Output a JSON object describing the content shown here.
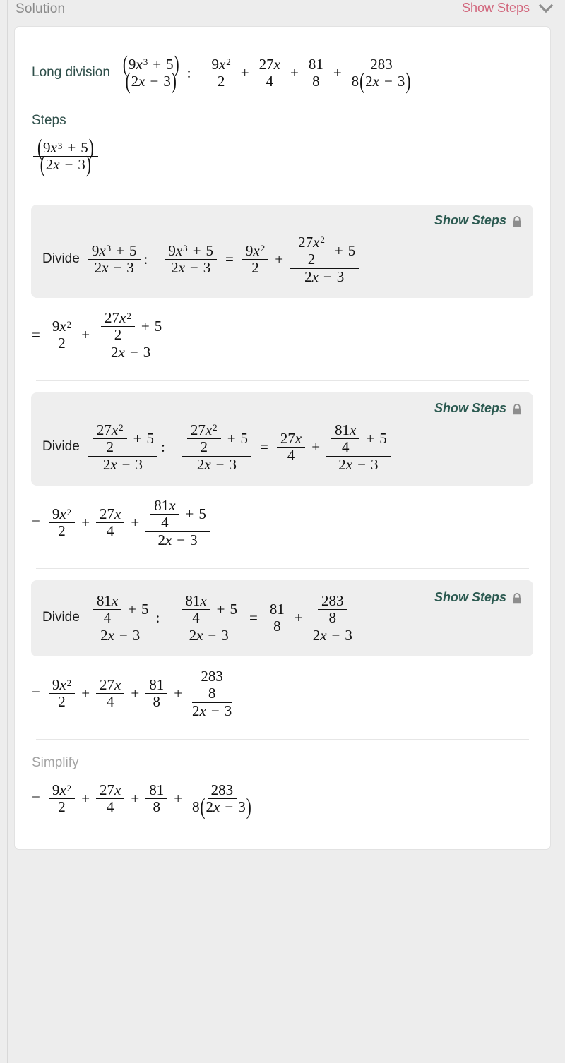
{
  "header": {
    "title": "Solution",
    "show_steps_label": "Show Steps",
    "chevron_icon": "chevron-down-icon",
    "show_steps_color": "#d2687e",
    "chevron_color": "#8f8f8f"
  },
  "card": {
    "long_division_label": "Long division",
    "steps_heading": "Steps",
    "simplify_heading": "Simplify",
    "divide_label": "Divide",
    "locked_show_steps_label": "Show Steps",
    "lock_icon": "lock-icon"
  },
  "math": {
    "colon": ":",
    "equals": "=",
    "plus": "+",
    "minus": "−",
    "x": "x",
    "nine": "9",
    "two": "2",
    "three": "3",
    "four": "4",
    "five": "5",
    "eight": "8",
    "twentyseven": "27",
    "eightyone": "81",
    "twoeightythree": "283",
    "exp3": "3",
    "exp2": "2"
  },
  "chart_data": {
    "type": "table",
    "title": "Long division of (9x^3 + 5) / (2x - 3)",
    "problem": "(9x^3 + 5) / (2x - 3)",
    "final_answer": "9x^2/2 + 27x/4 + 81/8 + 283/(8(2x - 3))",
    "steps": [
      {
        "label": "Divide",
        "operand": "(9x^3 + 5)/(2x - 3)",
        "result": "9x^2/2 + ((27x^2)/2 + 5)/(2x - 3)",
        "running_total": "9x^2/2 + ((27x^2)/2 + 5)/(2x - 3)",
        "locked": true
      },
      {
        "label": "Divide",
        "operand": "((27x^2)/2 + 5)/(2x - 3)",
        "result": "27x/4 + ((81x)/4 + 5)/(2x - 3)",
        "running_total": "9x^2/2 + 27x/4 + ((81x)/4 + 5)/(2x - 3)",
        "locked": true
      },
      {
        "label": "Divide",
        "operand": "((81x)/4 + 5)/(2x - 3)",
        "result": "81/8 + (283/8)/(2x - 3)",
        "running_total": "9x^2/2 + 27x/4 + 81/8 + (283/8)/(2x - 3)",
        "locked": true
      }
    ],
    "simplify_result": "9x^2/2 + 27x/4 + 81/8 + 283/(8(2x - 3))"
  }
}
